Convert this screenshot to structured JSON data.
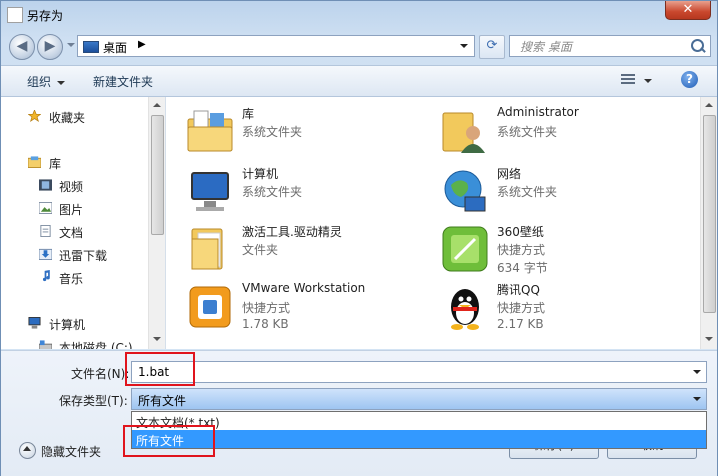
{
  "window": {
    "title": "另存为",
    "close_glyph": "✕"
  },
  "nav": {
    "back_glyph": "◀",
    "forward_glyph": "▶",
    "address": "桌面",
    "address_arrow": "▶",
    "refresh_glyph": "⟳",
    "search_placeholder": "搜索 桌面"
  },
  "toolbar": {
    "organize": "组织",
    "new_folder": "新建文件夹",
    "help": "?"
  },
  "sidebar": {
    "favorites": "收藏夹",
    "library": "库",
    "videos": "视频",
    "pictures": "图片",
    "documents": "文档",
    "thunder": "迅雷下载",
    "music": "音乐",
    "computer": "计算机",
    "local_disk": "本地磁盘 (C:)"
  },
  "files": [
    {
      "name": "库",
      "line2": "系统文件夹",
      "line3": ""
    },
    {
      "name": "Administrator",
      "line2": "系统文件夹",
      "line3": ""
    },
    {
      "name": "计算机",
      "line2": "系统文件夹",
      "line3": ""
    },
    {
      "name": "网络",
      "line2": "系统文件夹",
      "line3": ""
    },
    {
      "name": "激活工具.驱动精灵",
      "line2": "文件夹",
      "line3": ""
    },
    {
      "name": "360壁纸",
      "line2": "快捷方式",
      "line3": "634 字节"
    },
    {
      "name": "VMware Workstation",
      "line2": "快捷方式",
      "line3": "1.78 KB"
    },
    {
      "name": "腾讯QQ",
      "line2": "快捷方式",
      "line3": "2.17 KB"
    }
  ],
  "form": {
    "filename_label": "文件名(N):",
    "filename_value": "1.bat",
    "filetype_label": "保存类型(T):",
    "filetype_value": "所有文件",
    "options": [
      "文本文档(*.txt)",
      "所有文件"
    ]
  },
  "footer": {
    "hide_folders": "隐藏文件夹",
    "save": "保存(S)",
    "cancel": "取消"
  },
  "colors": {
    "highlight": "#3399ff",
    "annotation": "#e0141d"
  }
}
